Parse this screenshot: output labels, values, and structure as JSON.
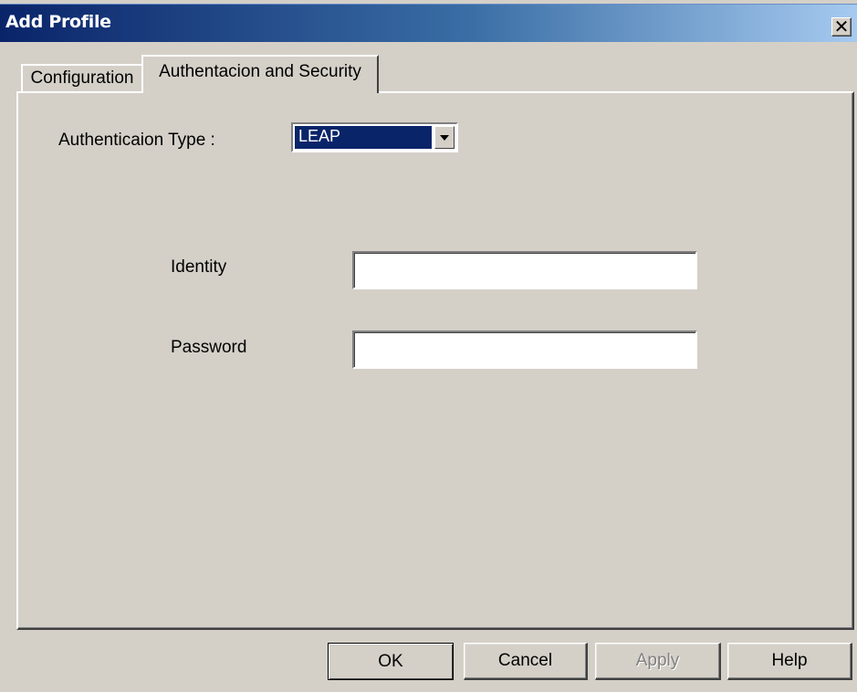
{
  "window": {
    "title": "Add Profile",
    "close_icon": "close-icon",
    "close_glyph": "✕"
  },
  "tabs": [
    {
      "label": "Configuration",
      "selected": false
    },
    {
      "label": "Authentacion and Security",
      "selected": true
    }
  ],
  "authentication": {
    "type_label": "Authenticaion Type :",
    "type_value": "LEAP",
    "dropdown_icon": "chevron-down-icon"
  },
  "fields": {
    "identity_label": "Identity",
    "identity_value": "",
    "password_label": "Password",
    "password_value": ""
  },
  "buttons": {
    "ok": "OK",
    "cancel": "Cancel",
    "apply": "Apply",
    "help": "Help",
    "apply_disabled": true
  },
  "colors": {
    "titlebar_start": "#0a246a",
    "titlebar_end": "#a6caf0",
    "face": "#d4d0c8",
    "selection": "#0a246a"
  }
}
